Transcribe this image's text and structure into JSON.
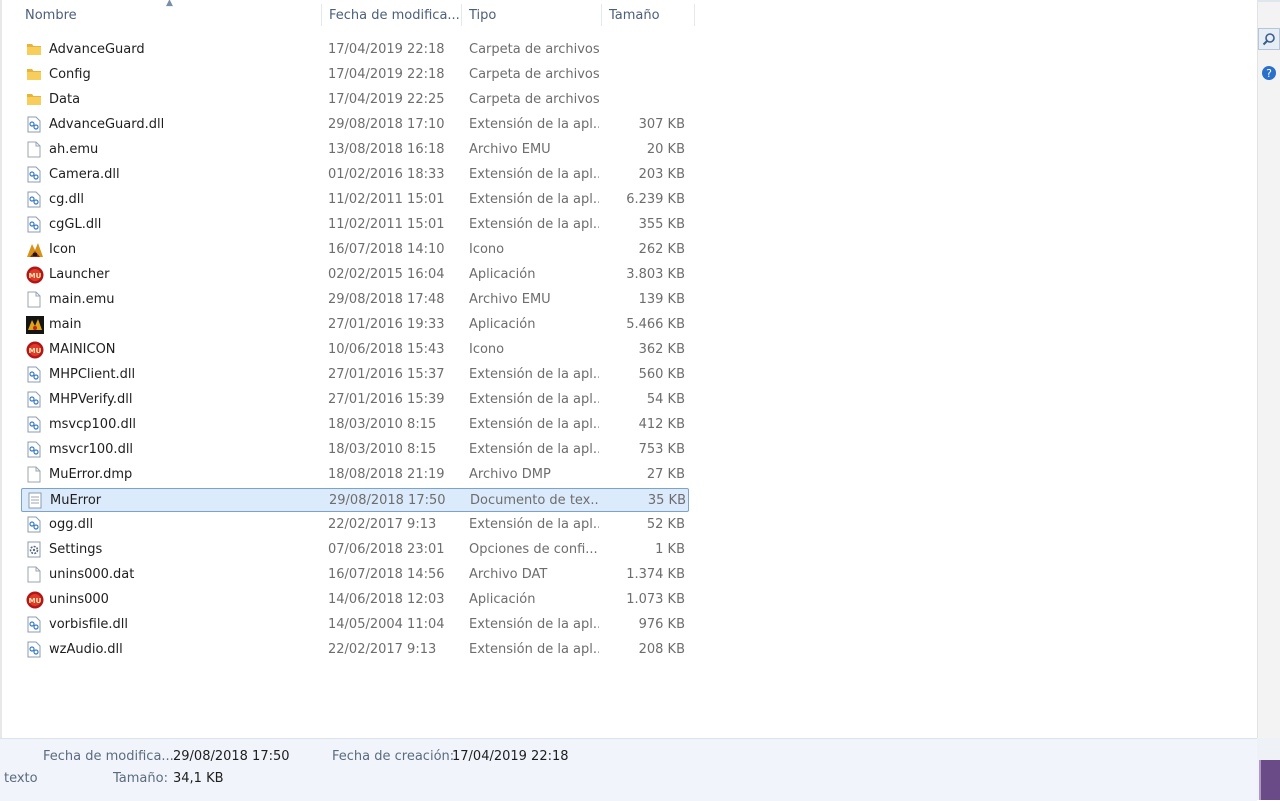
{
  "columns": {
    "name": "Nombre",
    "date": "Fecha de modifica...",
    "type": "Tipo",
    "size": "Tamaño"
  },
  "files": [
    {
      "name": "AdvanceGuard",
      "date": "17/04/2019 22:18",
      "type": "Carpeta de archivos",
      "size": "",
      "icon": "folder-icon"
    },
    {
      "name": "Config",
      "date": "17/04/2019 22:18",
      "type": "Carpeta de archivos",
      "size": "",
      "icon": "folder-icon"
    },
    {
      "name": "Data",
      "date": "17/04/2019 22:25",
      "type": "Carpeta de archivos",
      "size": "",
      "icon": "folder-icon"
    },
    {
      "name": "AdvanceGuard.dll",
      "date": "29/08/2018 17:10",
      "type": "Extensión de la apl...",
      "size": "307 KB",
      "icon": "dll-file-icon"
    },
    {
      "name": "ah.emu",
      "date": "13/08/2018 16:18",
      "type": "Archivo EMU",
      "size": "20 KB",
      "icon": "blank-file-icon"
    },
    {
      "name": "Camera.dll",
      "date": "01/02/2016 18:33",
      "type": "Extensión de la apl...",
      "size": "203 KB",
      "icon": "dll-file-icon"
    },
    {
      "name": "cg.dll",
      "date": "11/02/2011 15:01",
      "type": "Extensión de la apl...",
      "size": "6.239 KB",
      "icon": "dll-file-icon"
    },
    {
      "name": "cgGL.dll",
      "date": "11/02/2011 15:01",
      "type": "Extensión de la apl...",
      "size": "355 KB",
      "icon": "dll-file-icon"
    },
    {
      "name": "Icon",
      "date": "16/07/2018 14:10",
      "type": "Icono",
      "size": "262 KB",
      "icon": "game-icon-icon"
    },
    {
      "name": "Launcher",
      "date": "02/02/2015 16:04",
      "type": "Aplicación",
      "size": "3.803 KB",
      "icon": "mu-app-icon"
    },
    {
      "name": "main.emu",
      "date": "29/08/2018 17:48",
      "type": "Archivo EMU",
      "size": "139 KB",
      "icon": "blank-file-icon"
    },
    {
      "name": "main",
      "date": "27/01/2016 19:33",
      "type": "Aplicación",
      "size": "5.466 KB",
      "icon": "main-app-icon"
    },
    {
      "name": "MAINICON",
      "date": "10/06/2018 15:43",
      "type": "Icono",
      "size": "362 KB",
      "icon": "mu-app-icon"
    },
    {
      "name": "MHPClient.dll",
      "date": "27/01/2016 15:37",
      "type": "Extensión de la apl...",
      "size": "560 KB",
      "icon": "dll-file-icon"
    },
    {
      "name": "MHPVerify.dll",
      "date": "27/01/2016 15:39",
      "type": "Extensión de la apl...",
      "size": "54 KB",
      "icon": "dll-file-icon"
    },
    {
      "name": "msvcp100.dll",
      "date": "18/03/2010 8:15",
      "type": "Extensión de la apl...",
      "size": "412 KB",
      "icon": "dll-file-icon"
    },
    {
      "name": "msvcr100.dll",
      "date": "18/03/2010 8:15",
      "type": "Extensión de la apl...",
      "size": "753 KB",
      "icon": "dll-file-icon"
    },
    {
      "name": "MuError.dmp",
      "date": "18/08/2018 21:19",
      "type": "Archivo DMP",
      "size": "27 KB",
      "icon": "blank-file-icon"
    },
    {
      "name": "MuError",
      "date": "29/08/2018 17:50",
      "type": "Documento de tex...",
      "size": "35 KB",
      "icon": "text-file-icon",
      "selected": true
    },
    {
      "name": "ogg.dll",
      "date": "22/02/2017 9:13",
      "type": "Extensión de la apl...",
      "size": "52 KB",
      "icon": "dll-file-icon"
    },
    {
      "name": "Settings",
      "date": "07/06/2018 23:01",
      "type": "Opciones de confi...",
      "size": "1 KB",
      "icon": "settings-file-icon"
    },
    {
      "name": "unins000.dat",
      "date": "16/07/2018 14:56",
      "type": "Archivo DAT",
      "size": "1.374 KB",
      "icon": "blank-file-icon"
    },
    {
      "name": "unins000",
      "date": "14/06/2018 12:03",
      "type": "Aplicación",
      "size": "1.073 KB",
      "icon": "mu-app-icon"
    },
    {
      "name": "vorbisfile.dll",
      "date": "14/05/2004 11:04",
      "type": "Extensión de la apl...",
      "size": "976 KB",
      "icon": "dll-file-icon"
    },
    {
      "name": "wzAudio.dll",
      "date": "22/02/2017 9:13",
      "type": "Extensión de la apl...",
      "size": "208 KB",
      "icon": "dll-file-icon"
    }
  ],
  "details": {
    "type_fragment": "texto",
    "modified_label": "Fecha de modifica...",
    "modified_value": "29/08/2018 17:50",
    "size_label": "Tamaño:",
    "size_value": "34,1 KB",
    "created_label": "Fecha de creación:",
    "created_value": "17/04/2019 22:18"
  },
  "colors": {
    "selection_bg": "#dcebfc",
    "selection_border": "#7da2ce",
    "details_bg": "#f1f5fb",
    "header_text": "#4c607a"
  }
}
